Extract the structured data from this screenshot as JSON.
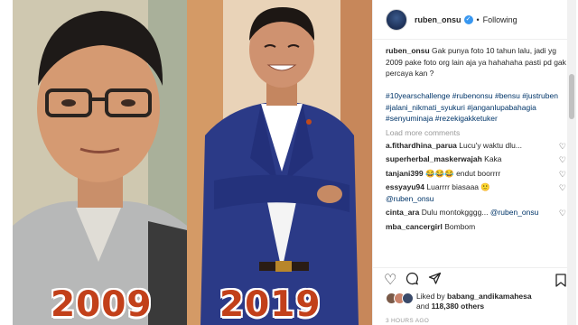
{
  "post": {
    "year_left": "2009",
    "year_right": "2019"
  },
  "header": {
    "username": "ruben_onsu",
    "verified_glyph": "✓",
    "separator": "•",
    "follow_status": "Following"
  },
  "caption": {
    "username": "ruben_onsu",
    "text": "Gak punya foto 10 tahun lalu, jadi yg 2009 pake foto org lain aja ya hahahaha pasti pd gak percaya kan ?",
    "hashtags": "#10yearschallenge #rubenonsu #bensu #justruben #jalani_nikmati_syukuri #janganlupabahagia #senyuminaja #rezekigakketuker"
  },
  "load_more": "Load more comments",
  "comments": [
    {
      "user": "a.fithardhina_parua",
      "text": "Lucu'y waktu dlu..."
    },
    {
      "user": "superherbal_maskerwajah",
      "text": "Kaka"
    },
    {
      "user": "tanjani399",
      "text": "😂😂😂 endut boorrrr"
    },
    {
      "user": "essyayu94",
      "text": "Luarrrr biasaaa 🙂",
      "mention": "@ruben_onsu"
    },
    {
      "user": "cinta_ara",
      "text": "Dulu montokgggg...",
      "mention": "@ruben_onsu"
    },
    {
      "user": "mba_cancergirl",
      "text": "Bombom"
    }
  ],
  "likes": {
    "prefix": "Liked by",
    "user": "babang_andikamahesa",
    "and": "and",
    "count": "118,380 others"
  },
  "timestamp": "3 HOURS AGO",
  "icons": {
    "heart": "heart-icon",
    "comment": "comment-icon",
    "share": "share-icon",
    "save": "bookmark-icon"
  },
  "colors": {
    "year_text": "#c2401a",
    "link": "#003569",
    "verified": "#3897f0",
    "muted": "#999999"
  }
}
